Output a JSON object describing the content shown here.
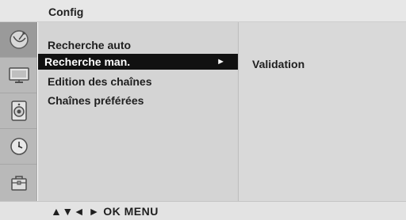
{
  "header": {
    "title": "Config"
  },
  "sidebar": {
    "icons": [
      {
        "name": "satellite-dish-icon",
        "active": true
      },
      {
        "name": "monitor-screen-icon",
        "active": false
      },
      {
        "name": "speaker-icon",
        "active": false
      },
      {
        "name": "clock-icon",
        "active": false
      },
      {
        "name": "toolbox-icon",
        "active": false
      }
    ]
  },
  "menu": {
    "items": [
      {
        "label": "Recherche auto",
        "selected": false
      },
      {
        "label": "Recherche man.",
        "selected": true,
        "arrow": "►"
      },
      {
        "label": "Edition des chaînes",
        "selected": false
      },
      {
        "label": "Chaînes préférées",
        "selected": false
      }
    ]
  },
  "submenu": {
    "label": "Validation"
  },
  "footer": {
    "hints": "▲▼◄ ► OK  MENU"
  },
  "colors": {
    "header_bg": "#e7e7e7",
    "iconbar_bg": "#b9b9b9",
    "menu_bg": "#d4d4d4",
    "selected_bg": "#111111",
    "selected_fg": "#ffffff"
  }
}
